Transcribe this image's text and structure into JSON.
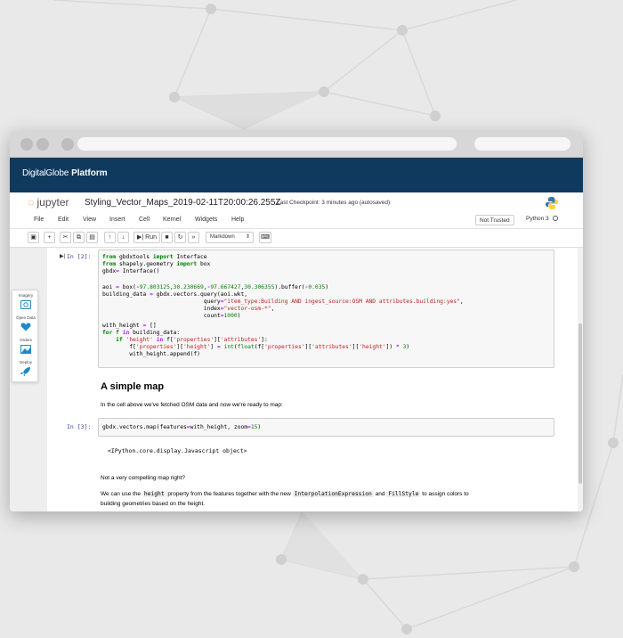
{
  "browser": {},
  "platform": {
    "brand": "DigitalGlobe",
    "product": "Platform"
  },
  "jupyter": {
    "logo_text": "jupyter",
    "notebook_title": "Styling_Vector_Maps_2019-02-11T20:00:26.255Z",
    "checkpoint": "Last Checkpoint: 3 minutes ago",
    "autosave": "(autosaved)",
    "trust": "Not Trusted",
    "kernel": "Python 3"
  },
  "menu": [
    "File",
    "Edit",
    "View",
    "Insert",
    "Cell",
    "Kernel",
    "Widgets",
    "Help"
  ],
  "toolbar": {
    "run_label": "Run",
    "cell_type": "Markdown",
    "icons": [
      "save-icon",
      "add-cell-icon",
      "cut-icon",
      "copy-icon",
      "paste-icon",
      "move-up-icon",
      "move-down-icon",
      "run-icon",
      "stop-icon",
      "restart-icon",
      "fast-forward-icon",
      "keyboard-icon"
    ]
  },
  "side_tools": {
    "items": [
      {
        "label": "Imagery",
        "icon": "imagery-icon"
      },
      {
        "label": "Open Data",
        "icon": "heart-icon"
      },
      {
        "label": "Orders",
        "icon": "orders-icon"
      },
      {
        "label": "Deploy",
        "icon": "rocket-icon"
      }
    ]
  },
  "cells": {
    "in2_prompt": "In [2]:",
    "in3_prompt": "In [3]:",
    "in3_code": "gbdx.vectors.map(features=with_height, zoom=15)",
    "out3": "<IPython.core.display.Javascript object>"
  },
  "markdown": {
    "heading": "A simple map",
    "p1": "In the cell above we've fetched OSM data and now we're ready to map:",
    "p2": "Not a very compelling map right?",
    "p3_a": "We can use the",
    "p3_code1": "height",
    "p3_b": "property from the features together with the new",
    "p3_code2": "InterpolationExpression",
    "p3_c": "and",
    "p3_code3": "FillStyle",
    "p3_d": "to assign colors to",
    "p4": "building geometries based on the height."
  },
  "colors": {
    "header_bg": "#0f3a5e",
    "jupyter_orange": "#f37726",
    "prompt_blue": "#303f9f",
    "keyword_green": "#008000",
    "string_red": "#ba2121"
  }
}
